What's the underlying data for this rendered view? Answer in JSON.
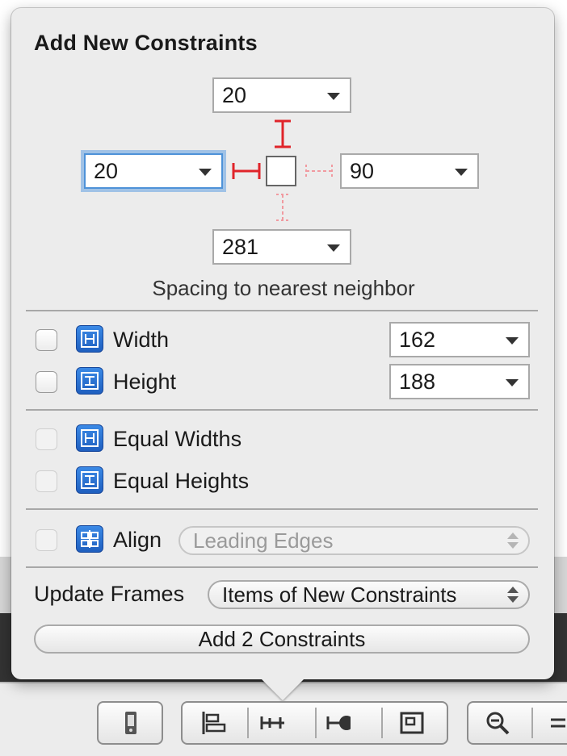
{
  "popover": {
    "title": "Add New Constraints",
    "spacing": {
      "top": "20",
      "left": "20",
      "right": "90",
      "bottom": "281",
      "caption": "Spacing to nearest neighbor"
    },
    "size": [
      {
        "label": "Width",
        "value": "162",
        "checked": false
      },
      {
        "label": "Height",
        "value": "188",
        "checked": false
      }
    ],
    "equal": [
      {
        "label": "Equal Widths",
        "checked": false
      },
      {
        "label": "Equal Heights",
        "checked": false
      }
    ],
    "align": {
      "label": "Align",
      "value": "Leading Edges"
    },
    "update_frames": {
      "label": "Update Frames",
      "value": "Items of New Constraints"
    },
    "add_button": "Add 2 Constraints"
  },
  "colors": {
    "constraint_active": "#e0242a",
    "constraint_inactive": "#f19aa0",
    "focus_ring": "#62a0e2",
    "icon_blue": "#2a6fd1"
  },
  "toolbar": {
    "icons": [
      "simulated-metrics-icon",
      "align-icon",
      "pin-icon",
      "resolve-issues-icon",
      "resizing-icon",
      "zoom-out-icon",
      "zoom-icon"
    ]
  }
}
